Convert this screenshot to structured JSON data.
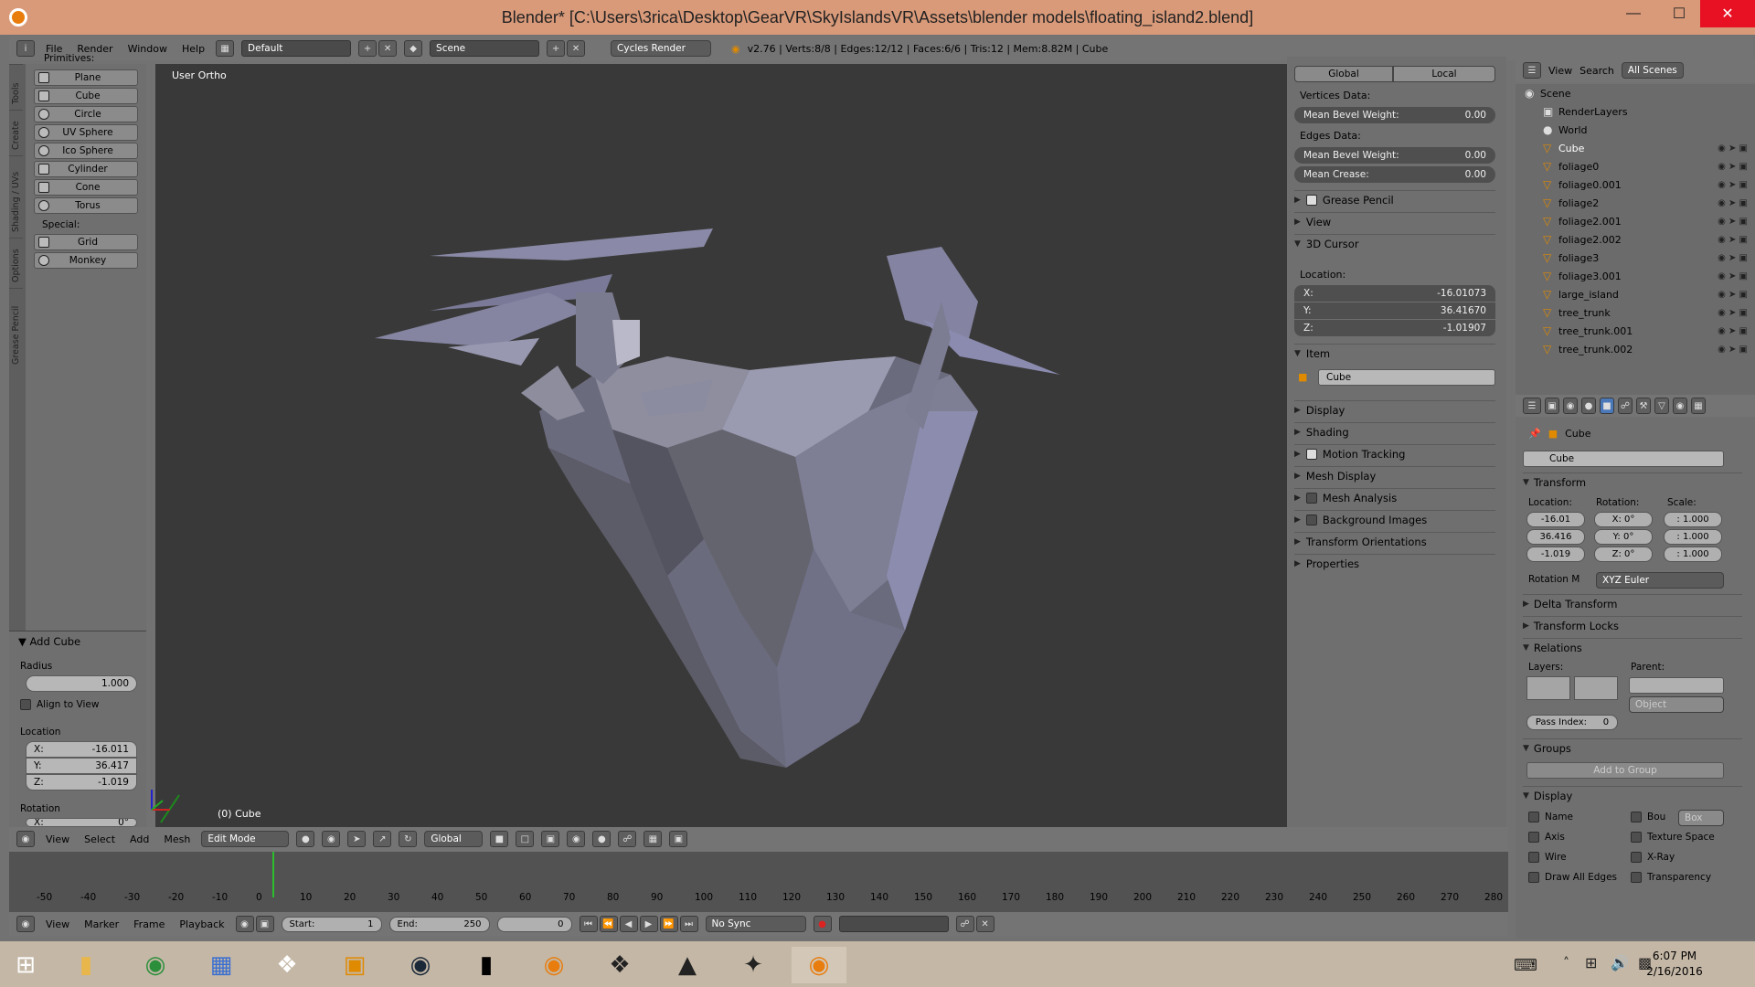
{
  "window": {
    "title": "Blender* [C:\\Users\\3rica\\Desktop\\GearVR\\SkyIslandsVR\\Assets\\blender models\\floating_island2.blend]"
  },
  "top_header": {
    "menus": [
      "File",
      "Render",
      "Window",
      "Help"
    ],
    "layout": "Default",
    "scene": "Scene",
    "engine": "Cycles Render",
    "stats": "v2.76 | Verts:8/8 | Edges:12/12 | Faces:6/6 | Tris:12 | Mem:8.82M | Cube"
  },
  "tool_tabs": [
    "Tools",
    "Create",
    "Shading / UVs",
    "Options",
    "Grease Pencil"
  ],
  "tool_shelf": {
    "section": "Primitives:",
    "primitives": [
      "Plane",
      "Cube",
      "Circle",
      "UV Sphere",
      "Ico Sphere",
      "Cylinder",
      "Cone",
      "Torus"
    ],
    "special_label": "Special:",
    "special": [
      "Grid",
      "Monkey"
    ]
  },
  "operator_panel": {
    "title": "Add Cube",
    "radius_label": "Radius",
    "radius": "1.000",
    "align_label": "Align to View",
    "location_label": "Location",
    "x": "-16.011",
    "y": "36.417",
    "z": "-1.019",
    "rotation_label": "Rotation",
    "rot_x": "0°"
  },
  "viewport": {
    "view_name": "User Ortho",
    "object_label": "(0) Cube"
  },
  "npanel": {
    "tabs": [
      "Global",
      "Local"
    ],
    "vertices_label": "Vertices Data:",
    "mean_bevel_v": {
      "label": "Mean Bevel Weight:",
      "value": "0.00"
    },
    "edges_label": "Edges Data:",
    "mean_bevel_e": {
      "label": "Mean Bevel Weight:",
      "value": "0.00"
    },
    "mean_crease": {
      "label": "Mean Crease:",
      "value": "0.00"
    },
    "grease": "Grease Pencil",
    "view": "View",
    "cursor": "3D Cursor",
    "location_label": "Location:",
    "cx": {
      "label": "X:",
      "value": "-16.01073"
    },
    "cy": {
      "label": "Y:",
      "value": "36.41670"
    },
    "cz": {
      "label": "Z:",
      "value": "-1.01907"
    },
    "item": "Item",
    "item_name": "Cube",
    "sections": [
      "Display",
      "Shading",
      "Motion Tracking",
      "Mesh Display",
      "Mesh Analysis",
      "Background Images",
      "Transform Orientations",
      "Properties"
    ]
  },
  "outliner": {
    "header": {
      "view": "View",
      "search": "Search",
      "filter": "All Scenes"
    },
    "items": [
      "Scene",
      "RenderLayers",
      "World",
      "Cube",
      "foliage0",
      "foliage0.001",
      "foliage2",
      "foliage2.001",
      "foliage2.002",
      "foliage3",
      "foliage3.001",
      "large_island",
      "tree_trunk",
      "tree_trunk.001",
      "tree_trunk.002"
    ]
  },
  "properties": {
    "breadcrumb": "Cube",
    "name": "Cube",
    "transform": "Transform",
    "location_label": "Location:",
    "rotation_label": "Rotation:",
    "scale_label": "Scale:",
    "loc": [
      "-16.01",
      "36.416",
      "-1.019"
    ],
    "rot": [
      "X:   0°",
      "Y:   0°",
      "Z:   0°"
    ],
    "scale": [
      ": 1.000",
      ": 1.000",
      ": 1.000"
    ],
    "rotation_mode_label": "Rotation M",
    "rotation_mode": "XYZ Euler",
    "delta": "Delta Transform",
    "locks": "Transform Locks",
    "relations": "Relations",
    "layers_label": "Layers:",
    "parent_label": "Parent:",
    "parent_type": "Object",
    "pass_index": "Pass Index:",
    "pass_value": "0",
    "groups": "Groups",
    "add_group": "Add to Group",
    "display": "Display",
    "disp_left": [
      "Name",
      "Axis",
      "Wire",
      "Draw All Edges"
    ],
    "disp_right": [
      "Bou",
      "Texture Space",
      "X-Ray",
      "Transparency"
    ],
    "bounds_type": "Box"
  },
  "viewport_header": {
    "menus": [
      "View",
      "Select",
      "Add",
      "Mesh"
    ],
    "mode": "Edit Mode",
    "orientation": "Global"
  },
  "timeline": {
    "ticks": [
      "-50",
      "-40",
      "-30",
      "-20",
      "-10",
      "0",
      "10",
      "20",
      "30",
      "40",
      "50",
      "60",
      "70",
      "80",
      "90",
      "100",
      "110",
      "120",
      "130",
      "140",
      "150",
      "160",
      "170",
      "180",
      "190",
      "200",
      "210",
      "220",
      "230",
      "240",
      "250",
      "260",
      "270",
      "280"
    ],
    "menus": [
      "View",
      "Marker",
      "Frame",
      "Playback"
    ],
    "start_label": "Start:",
    "start": "1",
    "end_label": "End:",
    "end": "250",
    "current": "0",
    "sync": "No Sync"
  },
  "taskbar": {
    "time": "6:07 PM",
    "date": "2/16/2016"
  }
}
